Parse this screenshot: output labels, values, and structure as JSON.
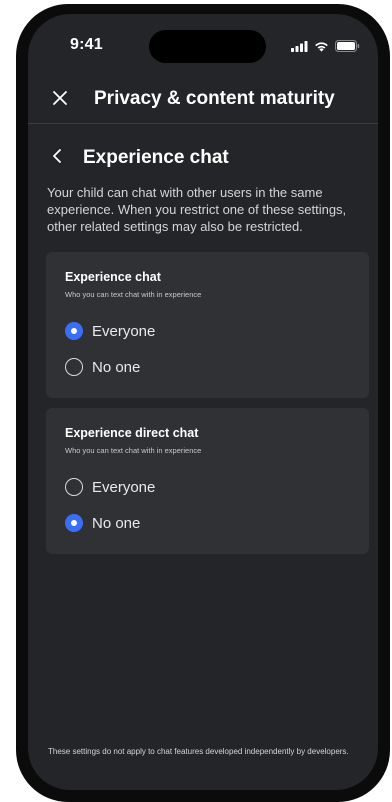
{
  "status_bar": {
    "time": "9:41",
    "icons": [
      "cellular-signal-icon",
      "wifi-icon",
      "battery-icon"
    ]
  },
  "header": {
    "close_icon": "close-icon",
    "title": "Privacy & content maturity"
  },
  "section": {
    "back_icon": "chevron-left-icon",
    "title": "Experience chat",
    "description": "Your child can chat with other users in the same experience. When you restrict one of these settings, other related settings may also be restricted."
  },
  "cards": [
    {
      "title": "Experience chat",
      "subtitle": "Who you can text chat with in experience",
      "options": [
        {
          "label": "Everyone",
          "selected": true
        },
        {
          "label": "No one",
          "selected": false
        }
      ]
    },
    {
      "title": "Experience direct chat",
      "subtitle": "Who you can text chat with in experience",
      "options": [
        {
          "label": "Everyone",
          "selected": false
        },
        {
          "label": "No one",
          "selected": true
        }
      ]
    }
  ],
  "footer": {
    "note": "These settings do not apply to chat features developed independently by developers."
  },
  "colors": {
    "background": "#232528",
    "card": "#2f3135",
    "accent": "#3b6ef6",
    "text": "#ffffff",
    "muted_text": "#d4d5d8"
  }
}
